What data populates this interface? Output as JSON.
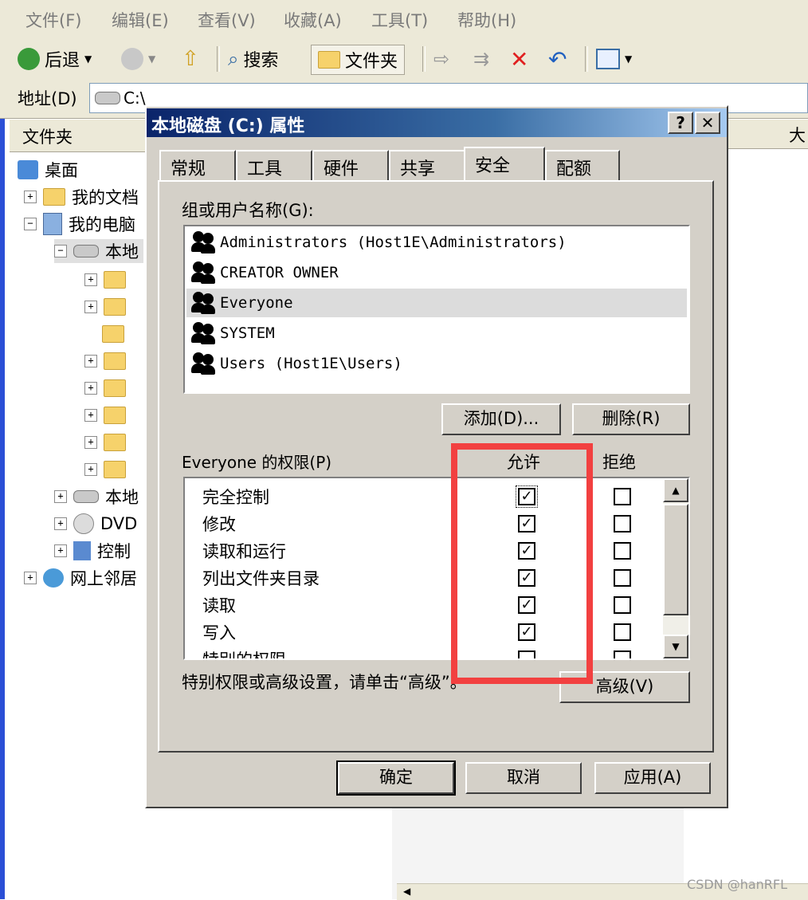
{
  "menu": [
    "文件(F)",
    "编辑(E)",
    "查看(V)",
    "收藏(A)",
    "工具(T)",
    "帮助(H)"
  ],
  "toolbar": {
    "back": "后退",
    "search": "搜索",
    "folders": "文件夹"
  },
  "address": {
    "label": "地址(D)",
    "value": "C:\\"
  },
  "folders_header": "文件夹",
  "right_header": "大",
  "tree": {
    "desktop": "桌面",
    "my_docs": "我的文档",
    "my_computer": "我的电脑",
    "local_c": "本地",
    "local_d": "本地",
    "dvd": "DVD",
    "control": "控制",
    "network": "网上邻居"
  },
  "dialog": {
    "title": "本地磁盘 (C:) 属性",
    "help_btn": "?",
    "close_btn": "✕",
    "tabs": [
      "常规",
      "工具",
      "硬件",
      "共享",
      "安全",
      "配额"
    ],
    "active_tab": "安全",
    "group_label": "组或用户名称(G):",
    "users": [
      "Administrators (Host1E\\Administrators)",
      "CREATOR OWNER",
      "Everyone",
      "SYSTEM",
      "Users (Host1E\\Users)"
    ],
    "selected_user": "Everyone",
    "add_btn": "添加(D)...",
    "remove_btn": "删除(R)",
    "perm_label": "Everyone 的权限(P)",
    "allow_header": "允许",
    "deny_header": "拒绝",
    "permissions": [
      {
        "name": "完全控制",
        "allow": true,
        "deny": false
      },
      {
        "name": "修改",
        "allow": true,
        "deny": false
      },
      {
        "name": "读取和运行",
        "allow": true,
        "deny": false
      },
      {
        "name": "列出文件夹目录",
        "allow": true,
        "deny": false
      },
      {
        "name": "读取",
        "allow": true,
        "deny": false
      },
      {
        "name": "写入",
        "allow": true,
        "deny": false
      },
      {
        "name": "特别的权限",
        "allow": false,
        "deny": false
      }
    ],
    "advanced_hint": "特别权限或高级设置，请单击“高级”。",
    "advanced_btn": "高级(V)",
    "ok_btn": "确定",
    "cancel_btn": "取消",
    "apply_btn": "应用(A)"
  },
  "highlight_color": "#f24040",
  "watermark": "CSDN @hanRFL"
}
